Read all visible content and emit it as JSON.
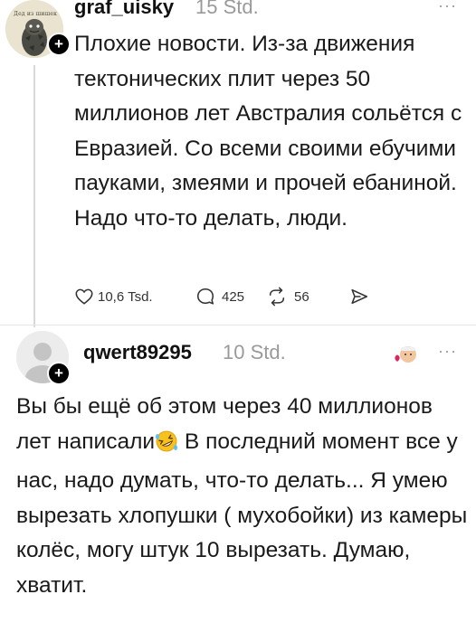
{
  "post1": {
    "avatar_caption": "Дед из шишек",
    "username": "graf_uisky",
    "time": "15 Std.",
    "more": "···",
    "follow_icon": "+",
    "text": "Плохие новости. Из-за движения тектонических плит через 50 миллионов лет Австралия сольётся с Евразией. Со всеми своими ебучими пауками, змеями и прочей ебаниной. Надо что-то делать, люди.",
    "actions": {
      "likes": "10,6 Tsd.",
      "comments": "425",
      "reposts": "56"
    }
  },
  "post2": {
    "username": "qwert89295",
    "time": "10 Std.",
    "more": "···",
    "follow_icon": "+",
    "text_part1": "Вы бы ещё об этом через 40 миллионов лет написали",
    "text_part2": " В последний момент все у нас, надо думать, что-то делать... Я умею вырезать хлопушки ( мухобойки) из камеры колёс, могу штук 10 вырезать. Думаю, хватит."
  },
  "colors": {
    "text": "#111111",
    "muted": "#9a9a9a",
    "thread_line": "#d9d9d9"
  },
  "icons": [
    "heart-icon",
    "comment-icon",
    "repost-icon",
    "share-icon",
    "more-icon",
    "follow-plus-icon",
    "rofl-emoji",
    "reaction-emoji"
  ]
}
